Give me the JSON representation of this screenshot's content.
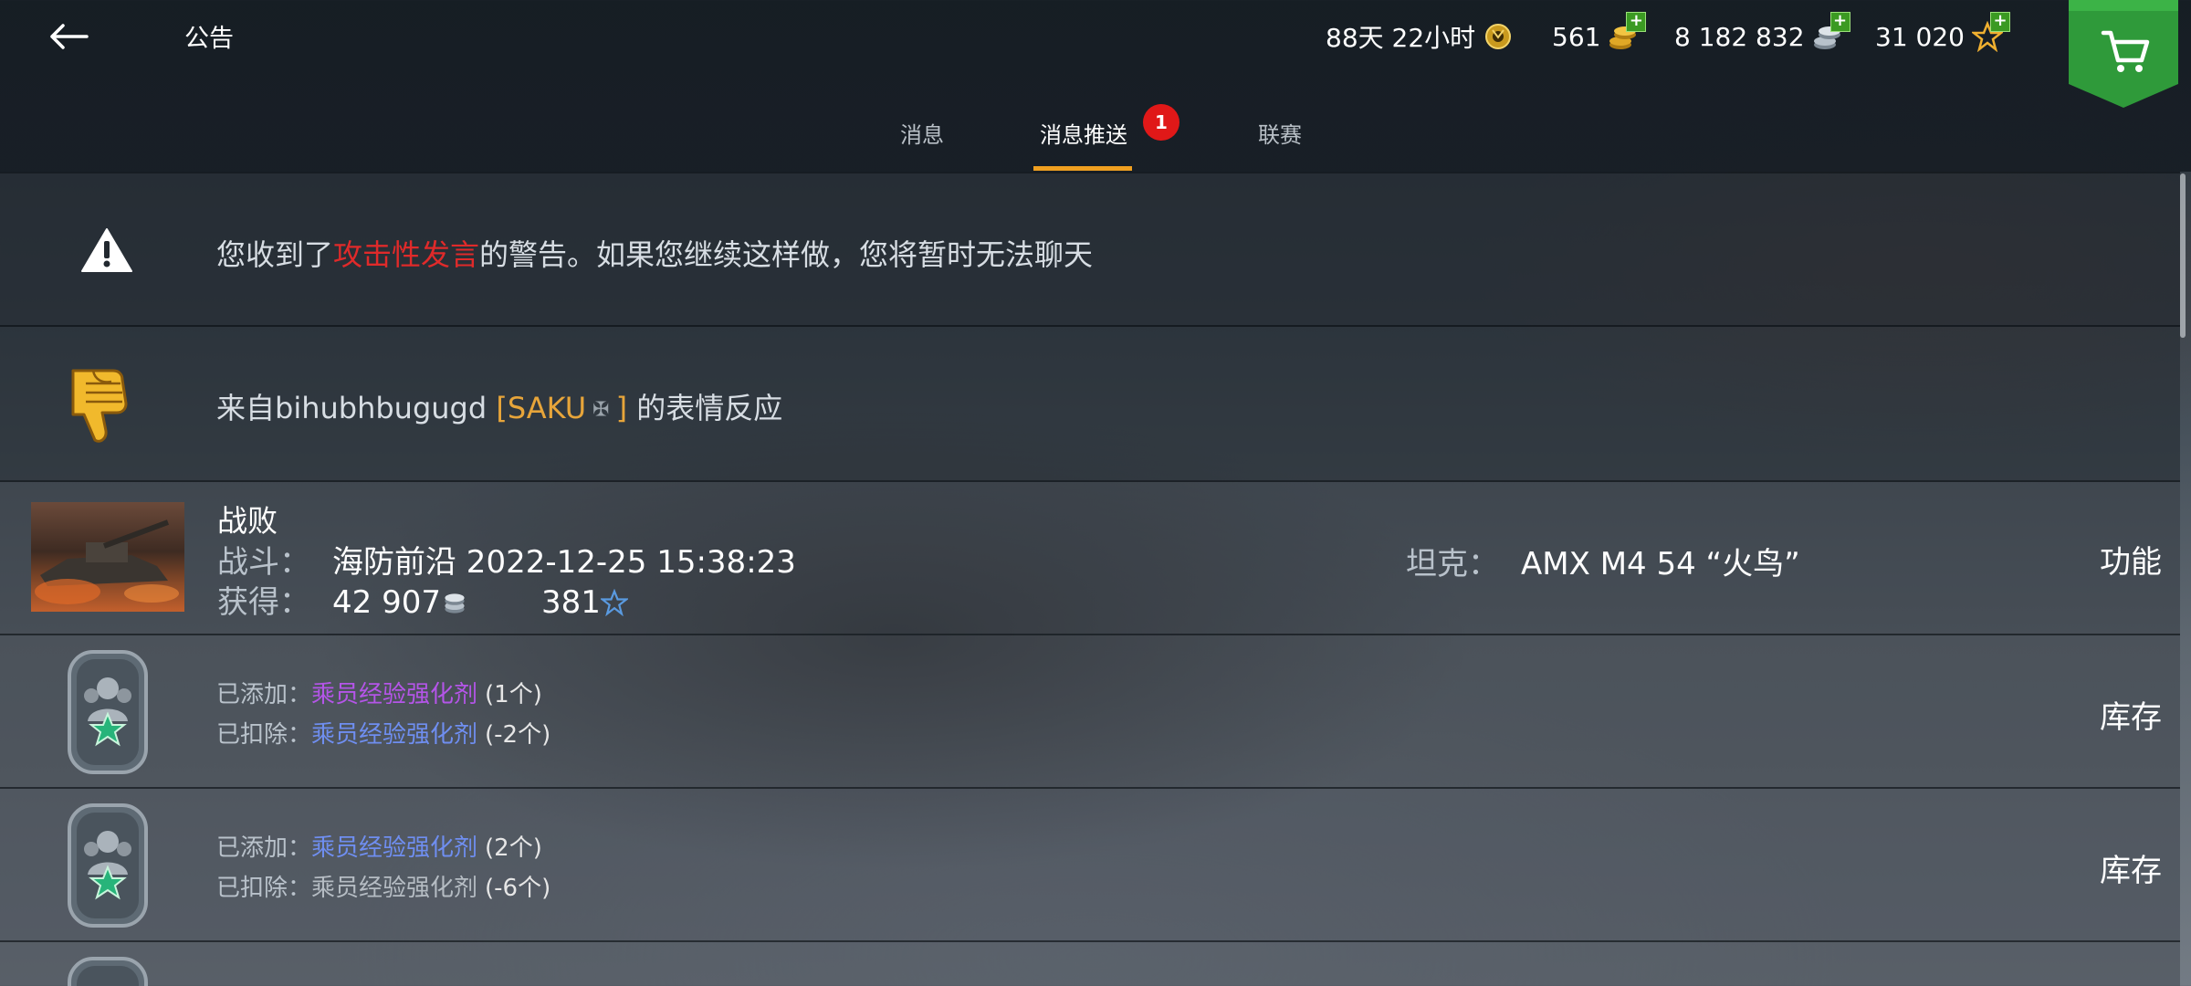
{
  "header": {
    "title": "公告",
    "premium_time": "88天 22小时",
    "gold": "561",
    "credits": "8 182 832",
    "free_xp": "31 020"
  },
  "tabs": [
    {
      "label": "消息"
    },
    {
      "label": "消息推送",
      "badge": "1"
    },
    {
      "label": "联赛"
    }
  ],
  "messages": {
    "warning": {
      "prefix": "您收到了",
      "highlight": "攻击性发言",
      "suffix": "的警告。如果您继续这样做，您将暂时无法聊天"
    },
    "reaction": {
      "prefix": "来自bihubhbugugd",
      "clan": "[SAKU",
      "clan_close": "]",
      "suffix": "的表情反应"
    },
    "battle": {
      "title": "战败",
      "battle_label": "战斗：",
      "battle_value": "海防前沿 2022-12-25 15:38:23",
      "earned_label": "获得：",
      "credits_earned": "42 907",
      "xp_earned": "381",
      "tank_label": "坦克：",
      "tank_value": "AMX M4 54 “火鸟”",
      "action": "功能"
    },
    "booster1": {
      "added_label": "已添加：",
      "added_item": "乘员经验强化剂",
      "added_qty": "(1个)",
      "removed_label": "已扣除：",
      "removed_item": "乘员经验强化剂",
      "removed_qty": "(-2个)",
      "action": "库存"
    },
    "booster2": {
      "added_label": "已添加：",
      "added_item": "乘员经验强化剂",
      "added_qty": "(2个)",
      "removed_label": "已扣除：",
      "removed_item": "乘员经验强化剂",
      "removed_qty": "(-6个)",
      "action": "库存"
    }
  },
  "colors": {
    "accent": "#f0a020",
    "warning_red": "#e02a2a",
    "clan_orange": "#e7a53a",
    "rare_purple": "#b455e8",
    "uncommon_blue": "#6f8ef0",
    "shop_green": "#2f9a3a",
    "badge_red": "#e01818"
  },
  "icons": {
    "back": "arrow-left-icon",
    "premium": "premium-account-icon",
    "gold": "gold-coins-icon",
    "credits": "credits-icon",
    "free_xp": "free-xp-star-icon",
    "shop": "shopping-cart-icon",
    "warning": "warning-triangle-icon",
    "reaction": "thumbs-down-icon",
    "booster": "crew-booster-dogtag-icon"
  }
}
